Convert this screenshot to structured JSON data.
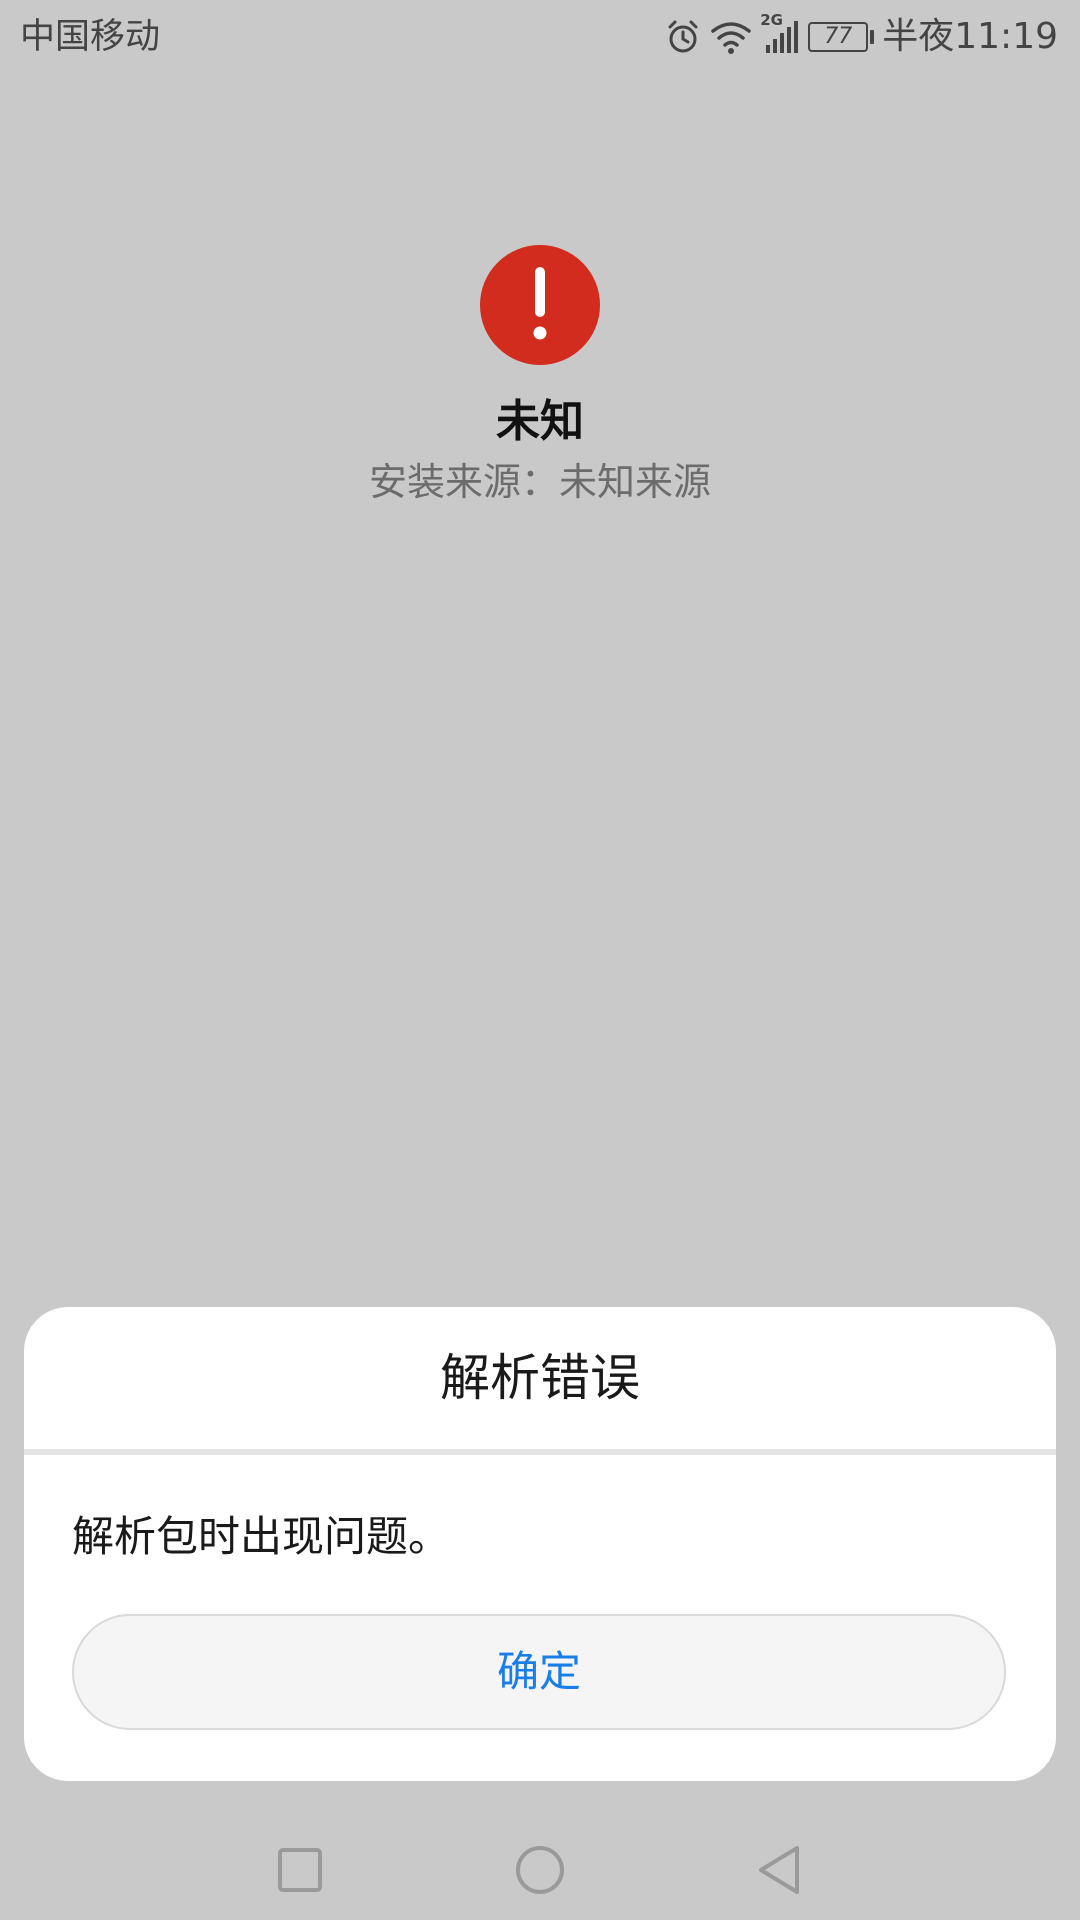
{
  "status_bar": {
    "carrier": "中国移动",
    "network_badge": "2G",
    "battery_level": "77",
    "time": "半夜11:19",
    "icons": [
      "alarm-icon",
      "wifi-icon",
      "signal-icon",
      "battery-icon"
    ]
  },
  "app": {
    "icon": "error-icon",
    "icon_color": "#d12c1d",
    "name": "未知",
    "source": "安装来源：未知来源"
  },
  "dialog": {
    "title": "解析错误",
    "message": "解析包时出现问题。",
    "confirm_label": "确定",
    "accent_color": "#1a7ee8"
  },
  "nav_bar": {
    "buttons": [
      "recents-icon",
      "home-icon",
      "back-icon"
    ]
  }
}
